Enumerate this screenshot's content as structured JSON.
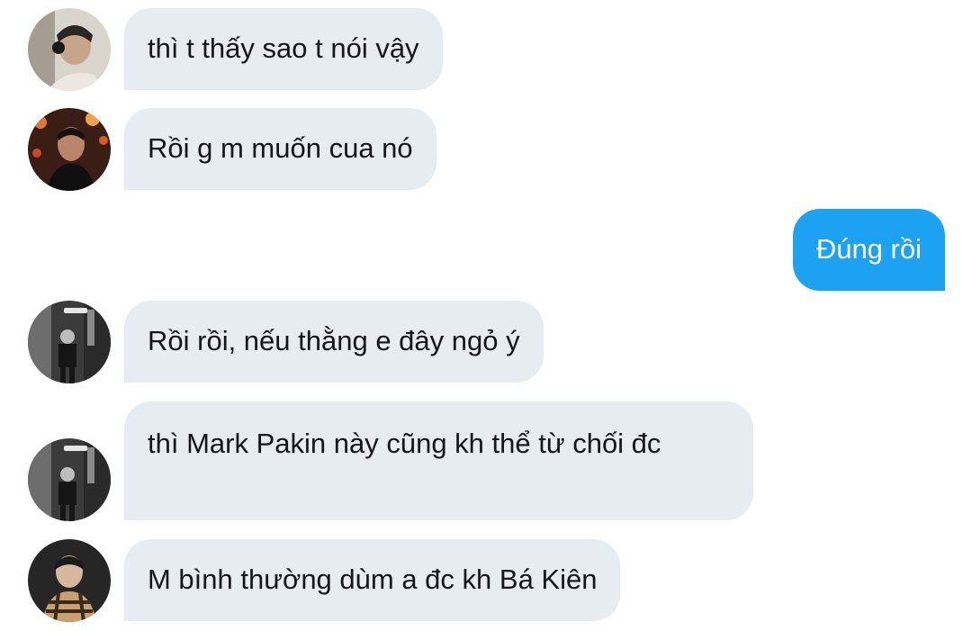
{
  "conversation": {
    "messages": [
      {
        "direction": "incoming",
        "avatar": "user-avatar-headphones",
        "text": "thì t thấy sao t nói vậy"
      },
      {
        "direction": "incoming",
        "avatar": "user-avatar-lights",
        "text": "Rồi g m muốn cua nó"
      },
      {
        "direction": "outgoing",
        "text": "Đúng rồi"
      },
      {
        "direction": "incoming",
        "avatar": "user-avatar-street-bw",
        "text": "Rồi rồi, nếu thằng e đây ngỏ ý"
      },
      {
        "direction": "incoming",
        "avatar": "user-avatar-street-bw",
        "text": "thì Mark Pakin này cũng kh thể từ chối đc"
      },
      {
        "direction": "incoming",
        "avatar": "user-avatar-plaid",
        "text": "M bình thường dùm a đc kh Bá Kiên"
      }
    ]
  },
  "colors": {
    "incoming_bubble": "#e6ecf0",
    "outgoing_bubble": "#1da1f2",
    "incoming_text": "#14171a",
    "outgoing_text": "#ffffff"
  }
}
